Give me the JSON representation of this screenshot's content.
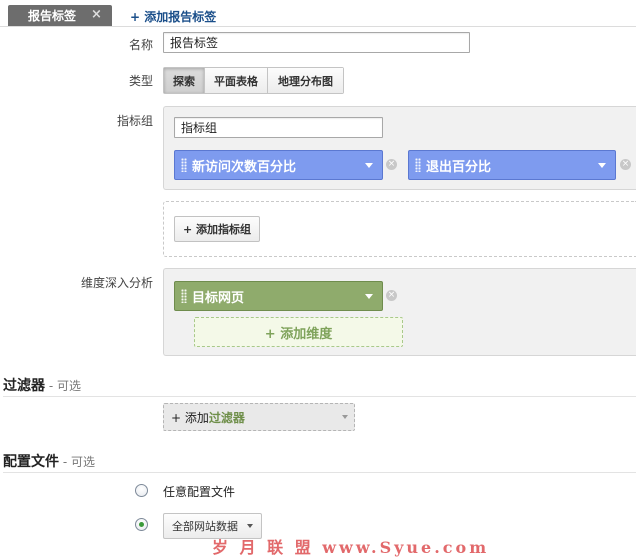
{
  "tabs": {
    "active_label": "报告标签",
    "close_glyph": "×",
    "add_label": "+ 添加报告标签"
  },
  "form": {
    "name_label": "名称",
    "name_value": "报告标签",
    "type_label": "类型",
    "type_options": [
      "探索",
      "平面表格",
      "地理分布图"
    ],
    "type_selected": "探索",
    "metric_group_label": "指标组",
    "metric_group_name": "指标组",
    "metrics": [
      "新访问次数百分比",
      "退出百分比"
    ],
    "add_metric_group": "+ 添加指标组",
    "dimension_label": "维度深入分析",
    "dimensions": [
      "目标网页"
    ],
    "add_dimension": "+ 添加维度"
  },
  "filters": {
    "title": "过滤器",
    "optional": " - 可选",
    "add_prefix": "+ 添加",
    "add_word": "过滤器"
  },
  "profiles": {
    "title": "配置文件",
    "optional": " - 可选",
    "option_any": "任意配置文件",
    "selected_value": "全部网站数据"
  },
  "watermark": "岁 月 联 盟   www.Syue.com",
  "colors": {
    "metric_pill": "#7e9bef",
    "dimension_pill": "#8fab6c",
    "active_tab": "#6d6d6d",
    "link": "#1b4f8a"
  }
}
